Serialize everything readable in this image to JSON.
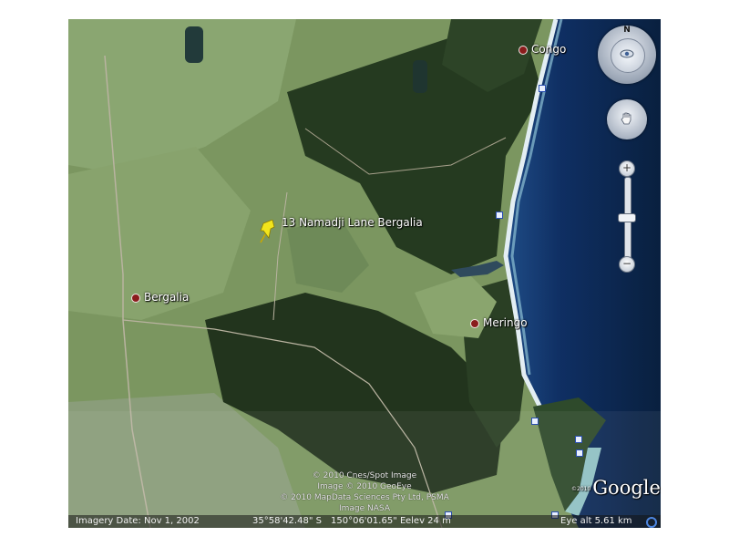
{
  "map": {
    "places": [
      {
        "id": "congo",
        "label": "Congo"
      },
      {
        "id": "bergalia",
        "label": "Bergalia"
      },
      {
        "id": "meringo",
        "label": "Meringo"
      }
    ],
    "pin": {
      "label": "13 Namadji Lane Bergalia",
      "icon": "pushpin-icon",
      "color": "#f2e51c"
    }
  },
  "controls": {
    "compass_north": "N",
    "zoom_in": "+",
    "zoom_out": "−"
  },
  "attribution": {
    "lines": [
      "© 2010 Cnes/Spot Image",
      "Image © 2010 GeoEye",
      "© 2010 MapData Sciences Pty Ltd, PSMA",
      "Image NASA"
    ],
    "logo_prefix": "©2010",
    "logo_text": "Google"
  },
  "status_bar": {
    "imagery_date": "Imagery Date: Nov 1, 2002",
    "latitude": "35°58'42.48\" S",
    "longitude": "150°06'01.65\" E",
    "elevation": "elev 24 m",
    "eye_alt": "Eye alt  5.61 km"
  },
  "colors": {
    "ocean": "#0d2c5a",
    "forest": "#22341d",
    "pasture": "#7f9b64",
    "surf": "#e8f2f5"
  }
}
